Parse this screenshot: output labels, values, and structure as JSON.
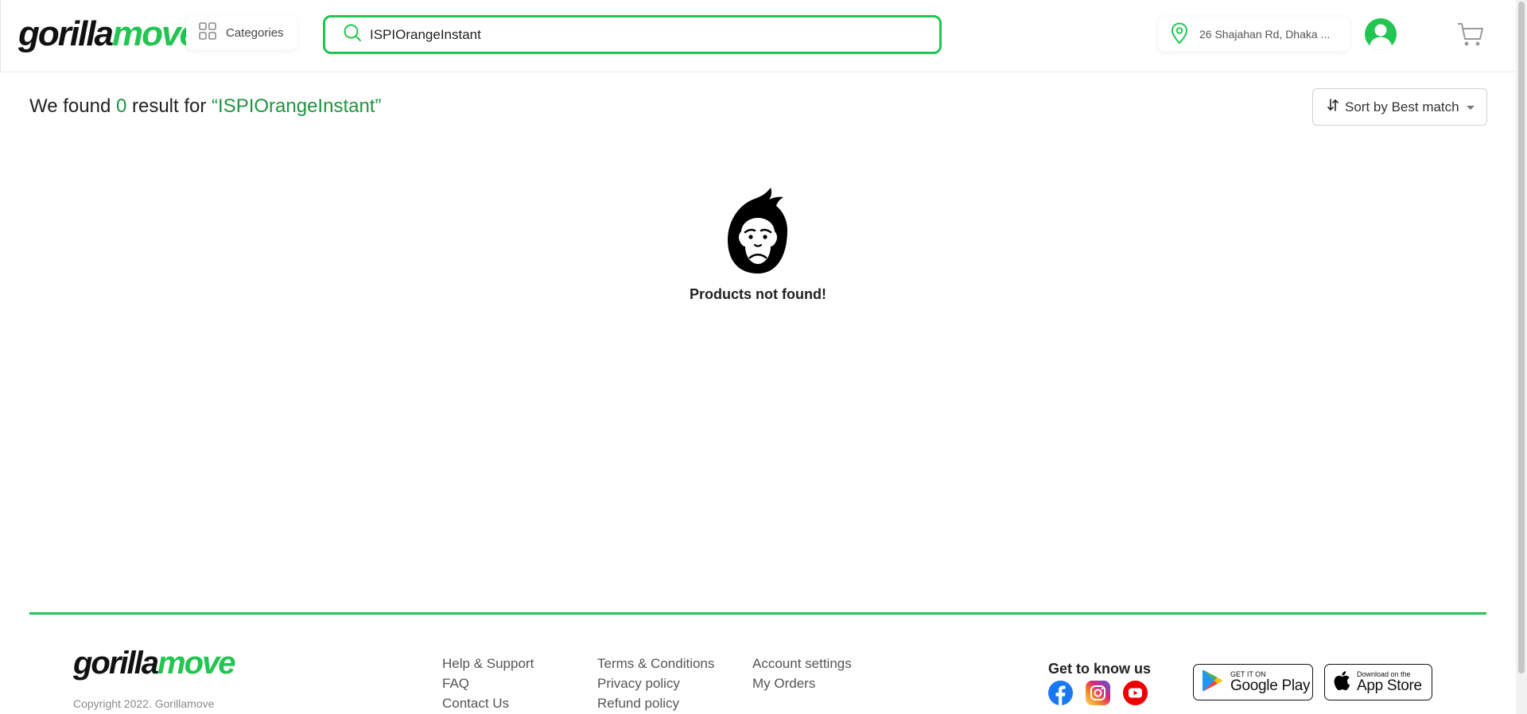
{
  "header": {
    "logo": {
      "part1": "gorilla",
      "part2": "move"
    },
    "categories_label": "Categories",
    "search_value": "ISPIOrangeInstant",
    "location": "26 Shajahan Rd, Dhaka ...",
    "icons": [
      "grid-icon",
      "search-icon",
      "location-pin-icon",
      "user-avatar-icon",
      "cart-icon"
    ]
  },
  "results": {
    "prefix": "We found ",
    "count": "0",
    "middle": " result for ",
    "query": "“ISPIOrangeInstant”",
    "sort_label": "Sort by Best match",
    "empty_message": "Products not found!"
  },
  "footer": {
    "logo": {
      "part1": "gorilla",
      "part2": "move"
    },
    "copyright": "Copyright 2022. Gorillamove",
    "col1": [
      "Help & Support",
      "FAQ",
      "Contact Us"
    ],
    "col2": [
      "Terms & Conditions",
      "Privacy policy",
      "Refund policy"
    ],
    "col3": [
      "Account settings",
      "My Orders"
    ],
    "social_heading": "Get to know us",
    "google_play": {
      "small": "GET IT ON",
      "big": "Google Play"
    },
    "app_store": {
      "small": "Download on the",
      "big": "App Store"
    }
  },
  "colors": {
    "brand_green": "#23c552",
    "text_green": "#1f9440",
    "dark": "#111111"
  }
}
